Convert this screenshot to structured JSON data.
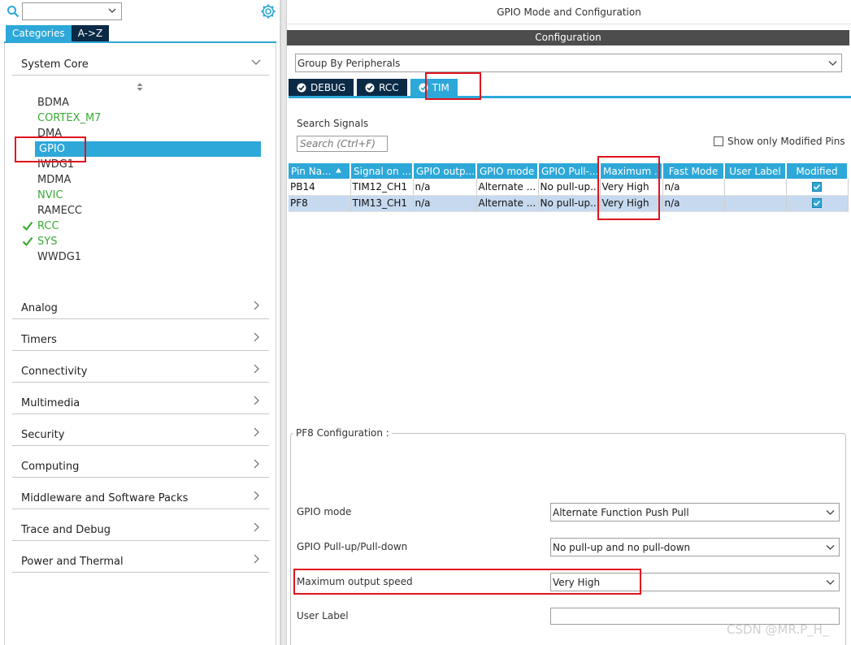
{
  "left_panel": {
    "search": {
      "value": ""
    },
    "category_tabs": [
      "Categories",
      "A->Z"
    ],
    "system_core": {
      "label": "System Core",
      "items": [
        {
          "label": "BDMA",
          "state": "normal"
        },
        {
          "label": "CORTEX_M7",
          "state": "green"
        },
        {
          "label": "DMA",
          "state": "normal"
        },
        {
          "label": "GPIO",
          "state": "selected"
        },
        {
          "label": "IWDG1",
          "state": "normal"
        },
        {
          "label": "MDMA",
          "state": "normal"
        },
        {
          "label": "NVIC",
          "state": "green"
        },
        {
          "label": "RAMECC",
          "state": "normal"
        },
        {
          "label": "RCC",
          "state": "checked"
        },
        {
          "label": "SYS",
          "state": "checked"
        },
        {
          "label": "WWDG1",
          "state": "normal"
        }
      ]
    },
    "sections": [
      "Analog",
      "Timers",
      "Connectivity",
      "Multimedia",
      "Security",
      "Computing",
      "Middleware and Software Packs",
      "Trace and Debug",
      "Power and Thermal"
    ]
  },
  "right_panel": {
    "title": "GPIO Mode and Configuration",
    "config_bar": "Configuration",
    "group_by": "Group By Peripherals",
    "peripheral_tabs": [
      "DEBUG",
      "RCC",
      "TIM"
    ],
    "active_tab": "TIM",
    "search_signals_label": "Search Signals",
    "search_placeholder": "Search (Ctrl+F)",
    "show_modified_label": "Show only Modified Pins",
    "show_modified_checked": false,
    "table": {
      "columns": [
        "Pin Na...",
        "Signal on ...",
        "GPIO outp...",
        "GPIO mode",
        "GPIO Pull-...",
        "Maximum ...",
        "Fast Mode",
        "User Label",
        "Modified"
      ],
      "rows": [
        [
          "PB14",
          "TIM12_CH1",
          "n/a",
          "Alternate ...",
          "No pull-up...",
          "Very High",
          "n/a",
          "",
          true
        ],
        [
          "PF8",
          "TIM13_CH1",
          "n/a",
          "Alternate ...",
          "No pull-up...",
          "Very High",
          "n/a",
          "",
          true
        ]
      ],
      "selected_row": 1
    },
    "pin_config": {
      "legend": "PF8 Configuration :",
      "fields": [
        {
          "label": "GPIO mode",
          "value": "Alternate Function Push Pull"
        },
        {
          "label": "GPIO Pull-up/Pull-down",
          "value": "No pull-up and no pull-down"
        },
        {
          "label": "Maximum output speed",
          "value": "Very High"
        },
        {
          "label": "User Label",
          "value": ""
        }
      ]
    }
  },
  "watermark": "CSDN @MR.P_H_",
  "colors": {
    "accent": "#2da8d8",
    "dark_tab": "#0b2a45",
    "green": "#3aaa35",
    "highlight": "#e0141e",
    "selected_row": "#c6d9ef"
  }
}
